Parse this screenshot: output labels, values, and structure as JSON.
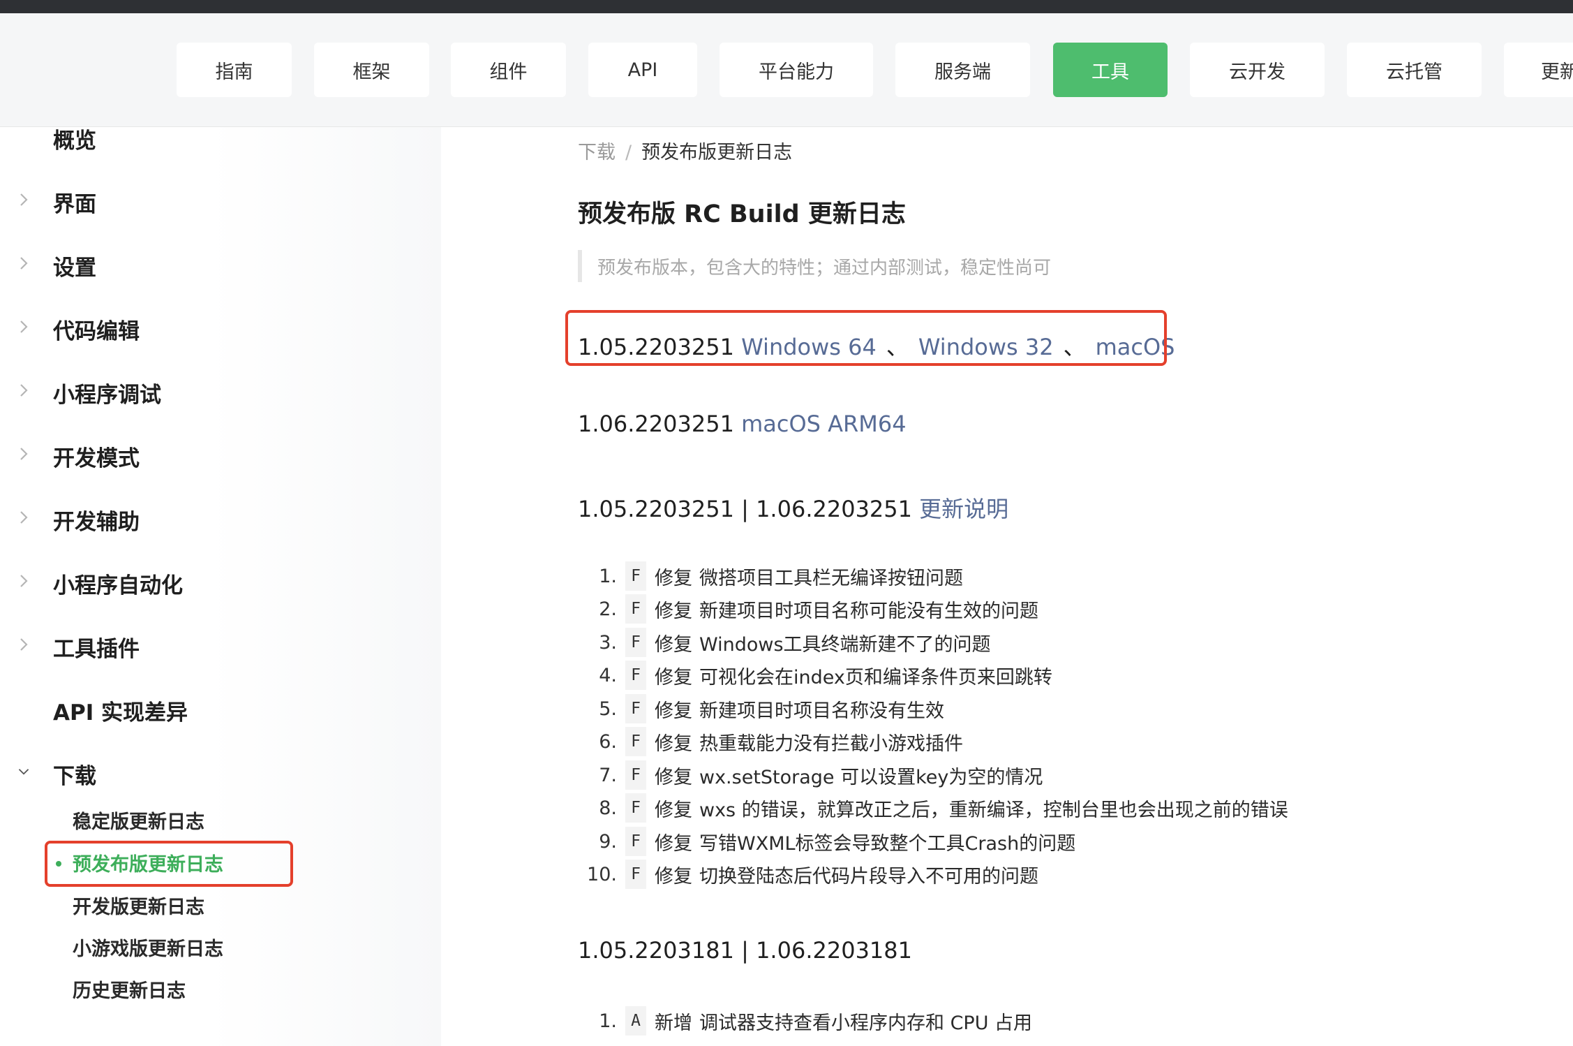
{
  "nav": {
    "tabs": [
      {
        "label": "指南",
        "active": false
      },
      {
        "label": "框架",
        "active": false
      },
      {
        "label": "组件",
        "active": false
      },
      {
        "label": "API",
        "active": false
      },
      {
        "label": "平台能力",
        "active": false
      },
      {
        "label": "服务端",
        "active": false
      },
      {
        "label": "工具",
        "active": true
      },
      {
        "label": "云开发",
        "active": false
      },
      {
        "label": "云托管",
        "active": false
      },
      {
        "label": "更新",
        "active": false
      }
    ],
    "active_color": "#4ebd6e"
  },
  "sidebar": {
    "items": [
      {
        "label": "概览",
        "chevron": "none"
      },
      {
        "label": "界面",
        "chevron": "right"
      },
      {
        "label": "设置",
        "chevron": "right"
      },
      {
        "label": "代码编辑",
        "chevron": "right"
      },
      {
        "label": "小程序调试",
        "chevron": "right"
      },
      {
        "label": "开发模式",
        "chevron": "right"
      },
      {
        "label": "开发辅助",
        "chevron": "right"
      },
      {
        "label": "小程序自动化",
        "chevron": "right"
      },
      {
        "label": "工具插件",
        "chevron": "right"
      },
      {
        "label": "API 实现差异",
        "chevron": "none"
      },
      {
        "label": "下载",
        "chevron": "down"
      }
    ],
    "sub_items": [
      {
        "label": "稳定版更新日志",
        "active": false
      },
      {
        "label": "预发布版更新日志",
        "active": true
      },
      {
        "label": "开发版更新日志",
        "active": false
      },
      {
        "label": "小游戏版更新日志",
        "active": false
      },
      {
        "label": "历史更新日志",
        "active": false
      }
    ],
    "active_color": "#3dae5a"
  },
  "main": {
    "breadcrumb": {
      "parent": "下载",
      "separator": "/",
      "current": "预发布版更新日志"
    },
    "title": "预发布版 RC Build 更新日志",
    "quote": "预发布版本，包含大的特性；通过内部测试，稳定性尚可",
    "downloads": [
      {
        "version": "1.05.2203251",
        "links": [
          "Windows 64",
          "Windows 32",
          "macOS"
        ],
        "separator": "、"
      },
      {
        "version": "1.06.2203251",
        "links": [
          "macOS ARM64"
        ],
        "separator": ""
      }
    ],
    "changelogs": [
      {
        "heading": "1.05.2203251 | 1.06.2203251",
        "link": "更新说明",
        "items": [
          {
            "num": "1.",
            "tag": "F",
            "kind": "修复",
            "text": "微搭项目工具栏无编译按钮问题"
          },
          {
            "num": "2.",
            "tag": "F",
            "kind": "修复",
            "text": "新建项目时项目名称可能没有生效的问题"
          },
          {
            "num": "3.",
            "tag": "F",
            "kind": "修复",
            "text": "Windows工具终端新建不了的问题"
          },
          {
            "num": "4.",
            "tag": "F",
            "kind": "修复",
            "text": "可视化会在index页和编译条件页来回跳转"
          },
          {
            "num": "5.",
            "tag": "F",
            "kind": "修复",
            "text": "新建项目时项目名称没有生效"
          },
          {
            "num": "6.",
            "tag": "F",
            "kind": "修复",
            "text": "热重载能力没有拦截小游戏插件"
          },
          {
            "num": "7.",
            "tag": "F",
            "kind": "修复",
            "text": "wx.setStorage 可以设置key为空的情况"
          },
          {
            "num": "8.",
            "tag": "F",
            "kind": "修复",
            "text": "wxs 的错误，就算改正之后，重新编译，控制台里也会出现之前的错误"
          },
          {
            "num": "9.",
            "tag": "F",
            "kind": "修复",
            "text": "写错WXML标签会导致整个工具Crash的问题"
          },
          {
            "num": "10.",
            "tag": "F",
            "kind": "修复",
            "text": "切换登陆态后代码片段导入不可用的问题"
          }
        ]
      },
      {
        "heading": "1.05.2203181 | 1.06.2203181",
        "link": "",
        "items": [
          {
            "num": "1.",
            "tag": "A",
            "kind": "新增",
            "text": "调试器支持查看小程序内存和 CPU 占用"
          }
        ]
      }
    ],
    "link_color": "#576b95",
    "highlight_color": "#e4402c"
  }
}
